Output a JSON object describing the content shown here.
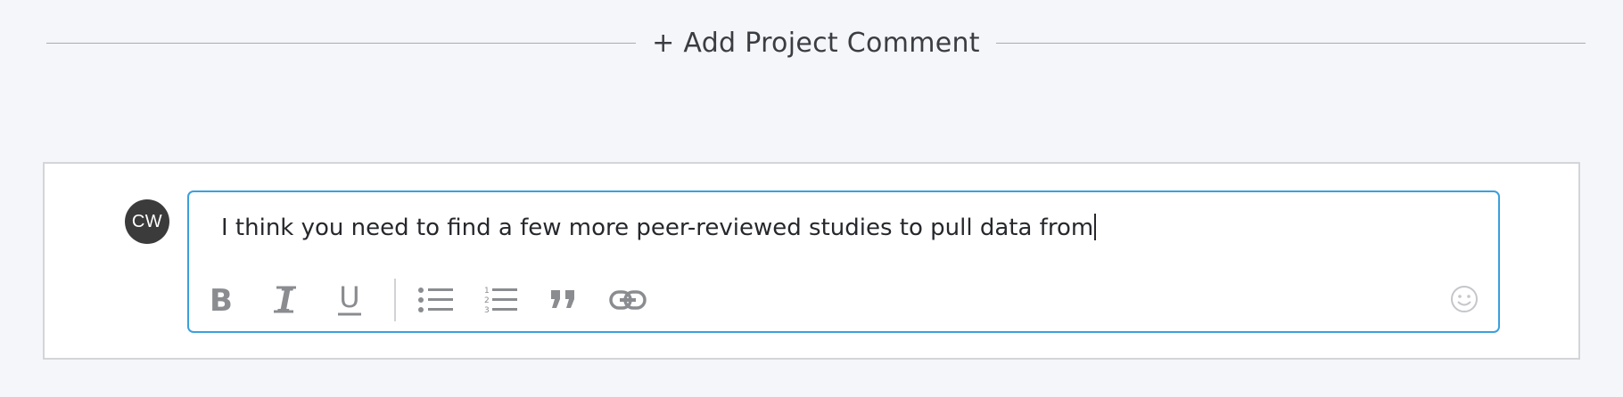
{
  "header": {
    "add_comment_label": "+ Add Project Comment"
  },
  "composer": {
    "avatar_initials": "CW",
    "text": "I think you need to find a few more peer-reviewed studies to pull data from",
    "toolbar": [
      {
        "name": "bold-icon",
        "glyph": "B"
      },
      {
        "name": "italic-icon",
        "glyph": "I"
      },
      {
        "name": "underline-icon",
        "glyph": "U"
      },
      {
        "name": "bulleted-list-icon"
      },
      {
        "name": "numbered-list-icon"
      },
      {
        "name": "quote-icon"
      },
      {
        "name": "link-icon"
      }
    ],
    "emoji_icon": "smiley-icon"
  },
  "colors": {
    "background": "#f5f6f9",
    "accent_border": "#3aa0dd",
    "icon_gray": "#8a8c90",
    "avatar_bg": "#3b3b3b"
  }
}
